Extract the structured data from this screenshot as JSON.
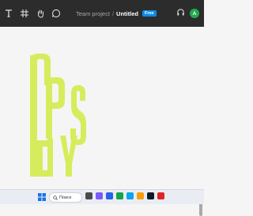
{
  "toolbar": {
    "project": "Team project",
    "separator": "/",
    "file_name": "Untitled",
    "badge": "Free",
    "avatar_initial": "A"
  },
  "taskbar": {
    "search_placeholder": "Поиск"
  },
  "colors": {
    "toolbar_bg": "#2c2c2c",
    "canvas_bg": "#f5f5f5",
    "accent": "#0c8ce9",
    "art_lime": "#d7ec5c",
    "avatar": "#22a84f"
  },
  "icons": [
    "text-tool-icon",
    "frame-tool-icon",
    "hand-tool-icon",
    "comment-tool-icon",
    "headphones-icon",
    "windows-start-icon",
    "search-icon"
  ]
}
